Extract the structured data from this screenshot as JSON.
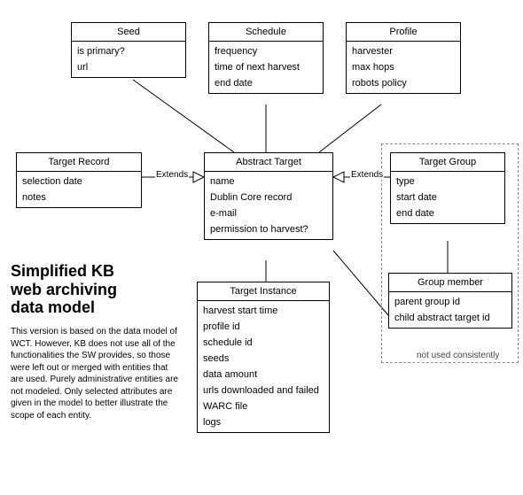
{
  "chart_data": {
    "type": "diagram",
    "title": "Simplified KB web archiving data model",
    "description": "This version is based on the data model of WCT. However, KB does not use all of the functionalities the SW provides, so those were left out or merged with entities that are used. Purely administrative entities are not modeled. Only selected attributes are given in the model to better illustrate the scope of each entity.",
    "entities": [
      {
        "id": "seed",
        "name": "Seed",
        "attributes": [
          "is primary?",
          "url"
        ]
      },
      {
        "id": "schedule",
        "name": "Schedule",
        "attributes": [
          "frequency",
          "time of next harvest",
          "end date"
        ]
      },
      {
        "id": "profile",
        "name": "Profile",
        "attributes": [
          "harvester",
          "max hops",
          "robots policy"
        ]
      },
      {
        "id": "target_record",
        "name": "Target Record",
        "attributes": [
          "selection date",
          "notes"
        ]
      },
      {
        "id": "abstract_target",
        "name": "Abstract Target",
        "attributes": [
          "name",
          "Dublin Core record",
          "e-mail",
          "permission to harvest?"
        ]
      },
      {
        "id": "target_group",
        "name": "Target Group",
        "attributes": [
          "type",
          "start date",
          "end date"
        ]
      },
      {
        "id": "group_member",
        "name": "Group member",
        "attributes": [
          "parent group id",
          "child abstract target id"
        ]
      },
      {
        "id": "target_instance",
        "name": "Target Instance",
        "attributes": [
          "harvest start time",
          "profile id",
          "schedule id",
          "seeds",
          "data amount",
          "urls downloaded and failed",
          "WARC file",
          "logs"
        ]
      }
    ],
    "relations": [
      {
        "from": "seed",
        "to": "abstract_target",
        "type": "association"
      },
      {
        "from": "schedule",
        "to": "abstract_target",
        "type": "association"
      },
      {
        "from": "profile",
        "to": "abstract_target",
        "type": "association"
      },
      {
        "from": "target_record",
        "to": "abstract_target",
        "type": "extends",
        "label": "Extends"
      },
      {
        "from": "target_group",
        "to": "abstract_target",
        "type": "extends",
        "label": "Extends"
      },
      {
        "from": "target_group",
        "to": "group_member",
        "type": "association"
      },
      {
        "from": "group_member",
        "to": "abstract_target",
        "type": "association"
      },
      {
        "from": "abstract_target",
        "to": "target_instance",
        "type": "association"
      }
    ],
    "groups": [
      {
        "id": "unused_group",
        "members": [
          "target_group",
          "group_member"
        ],
        "caption": "not used consistently"
      }
    ]
  },
  "heading": {
    "title_l1": "Simplified KB",
    "title_l2": "web archiving",
    "title_l3": "data model",
    "paragraph": "This version is based on the data model of WCT. However, KB does not use all of the functionalities the SW provides, so those were left out or merged with entities that are used. Purely administrative entities are not modeled. Only selected attributes are given in the model to better illustrate the scope of each entity."
  },
  "labels": {
    "extends_left": "Extends",
    "extends_right": "Extends",
    "group_caption": "not used consistently"
  },
  "entities": {
    "seed": {
      "title": "Seed",
      "a0": "is primary?",
      "a1": "url"
    },
    "schedule": {
      "title": "Schedule",
      "a0": "frequency",
      "a1": "time of next harvest",
      "a2": "end date"
    },
    "profile": {
      "title": "Profile",
      "a0": "harvester",
      "a1": "max hops",
      "a2": "robots policy"
    },
    "target_record": {
      "title": "Target Record",
      "a0": "selection date",
      "a1": "notes"
    },
    "abstract_target": {
      "title": "Abstract Target",
      "a0": "name",
      "a1": "Dublin Core record",
      "a2": "e-mail",
      "a3": "permission to harvest?"
    },
    "target_group": {
      "title": "Target Group",
      "a0": "type",
      "a1": "start date",
      "a2": "end date"
    },
    "group_member": {
      "title": "Group member",
      "a0": "parent group id",
      "a1": "child abstract target id"
    },
    "target_instance": {
      "title": "Target Instance",
      "a0": "harvest start time",
      "a1": "profile id",
      "a2": "schedule id",
      "a3": "seeds",
      "a4": "data amount",
      "a5": "urls downloaded and failed",
      "a6": "WARC file",
      "a7": "logs"
    }
  }
}
